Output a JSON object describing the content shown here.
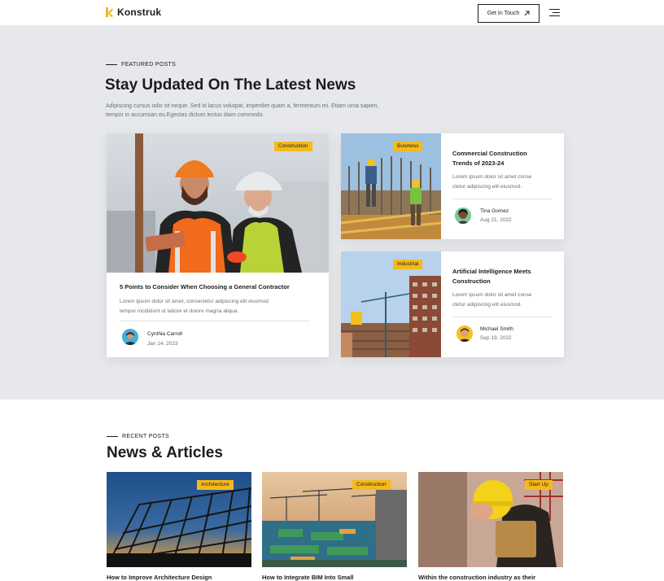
{
  "header": {
    "brand": "Konstruk",
    "cta_label": "Get In Touch",
    "brand_color": "#f5b91c"
  },
  "featured": {
    "eyebrow": "FEATURED POSTS",
    "title": "Stay Updated On The Latest News",
    "description": "Adipiscing cursus odio sit neque. Sed id lacus volutpat, imperdiet quam a, fermentum mi. Etiam urna sapien, tempor in accumsan eu.Egestas dictum lectus diam commodo.",
    "main_post": {
      "tag": "Construction",
      "title": "5 Points to Consider When Choosing a General Contractor",
      "excerpt_line1": "Lorem ipsum dolor sit amet, consectetur adipiscing elit eiusmod",
      "excerpt_line2": "tempor incididunt ut labore et dolore magna aliqua.",
      "author": "Cynthia Carroll",
      "date": "Jan 14, 2023"
    },
    "side_posts": [
      {
        "tag": "Business",
        "title_line1": "Commercial Construction",
        "title_line2": "Trends of 2023-24",
        "excerpt_line1": "Lorem ipsum dolor sit amet conse",
        "excerpt_line2": "ctetur adipiscing elit eiusmod.",
        "author": "Tina Gomez",
        "date": "Aug 21, 2022"
      },
      {
        "tag": "Industrial",
        "title_line1": "Artificial Intelligence Meets",
        "title_line2": "Construction",
        "excerpt_line1": "Lorem ipsum dolor sit amet conse",
        "excerpt_line2": "ctetur adipiscing elit eiusmod.",
        "author": "Michael Smith",
        "date": "Sep 19, 2022"
      }
    ]
  },
  "recent": {
    "eyebrow": "RECENT POSTS",
    "title": "News & Articles",
    "posts": [
      {
        "tag": "Architecture",
        "title": "How to Improve Architecture Design"
      },
      {
        "tag": "Construction",
        "title": "How to Integrate BIM Into Small"
      },
      {
        "tag": "Start Up",
        "title": "Within the construction industry as their"
      }
    ]
  }
}
